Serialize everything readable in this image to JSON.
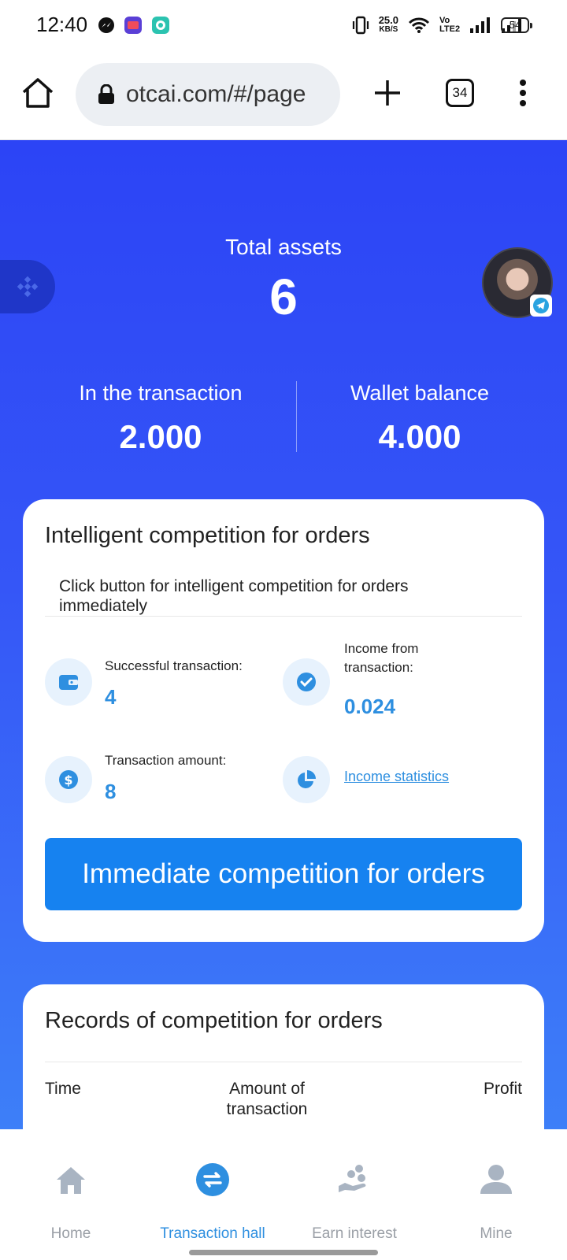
{
  "status_bar": {
    "time": "12:40",
    "net_speed": "25.0",
    "net_unit": "KB/S",
    "volte": "Vo LTE2",
    "battery": "54"
  },
  "browser": {
    "url": "otcai.com/#/page",
    "tab_count": "34"
  },
  "hero": {
    "total_label": "Total assets",
    "total_value": "6",
    "in_transaction_label": "In the transaction",
    "in_transaction_value": "2.000",
    "wallet_label": "Wallet balance",
    "wallet_value": "4.000"
  },
  "orders_card": {
    "title": "Intelligent competition for orders",
    "description": "Click button for intelligent competition for orders immediately",
    "successful_label": "Successful transaction:",
    "successful_value": "4",
    "income_label": "Income from transaction:",
    "income_value": "0.024",
    "amount_label": "Transaction amount:",
    "amount_value": "8",
    "stats_link": "Income statistics",
    "button_label": "Immediate competition for orders"
  },
  "records_card": {
    "title": "Records of competition for orders",
    "columns": [
      "Time",
      "Amount of transaction",
      "Profit"
    ]
  },
  "bottom_nav": {
    "items": [
      {
        "label": "Home",
        "icon": "home-icon"
      },
      {
        "label": "Transaction hall",
        "icon": "exchange-icon"
      },
      {
        "label": "Earn interest",
        "icon": "earn-interest-icon"
      },
      {
        "label": "Mine",
        "icon": "user-icon"
      }
    ],
    "active_index": 1
  },
  "colors": {
    "hero_blue": "#2c44f6",
    "accent_blue": "#1682f0",
    "value_blue": "#2e8fe0"
  }
}
